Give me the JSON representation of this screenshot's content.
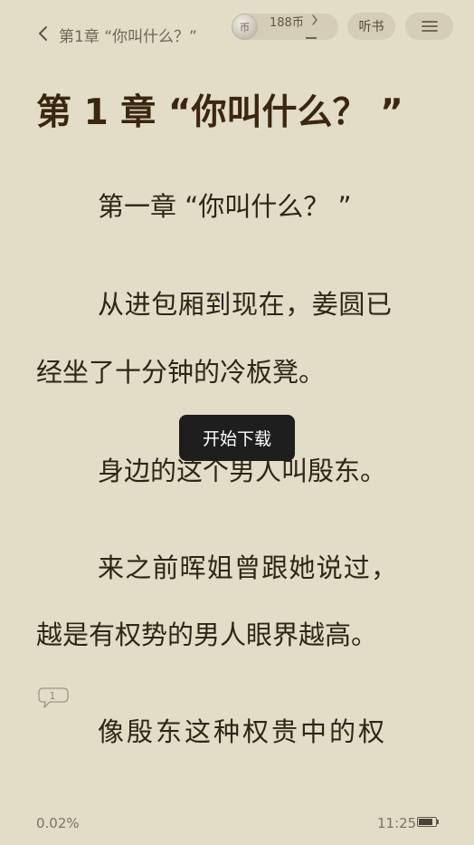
{
  "header": {
    "chapter_title": "第1章 “你叫什么？”",
    "coins": "188币",
    "coin_icon_glyph": "币",
    "listen_label": "听书"
  },
  "content": {
    "heading": "第 1 章 “你叫什么？ ”",
    "lines": [
      "第一章 “你叫什么？ ”",
      "从进包厢到现在，姜圆已",
      "经坐了十分钟的冷板凳。",
      "身边的这个男人叫殷东。",
      "来之前晖姐曾跟她说过，",
      "越是有权势的男人眼界越高。",
      "像殷东这种权贵中的权"
    ],
    "comment_count": "1"
  },
  "toast": {
    "message": "开始下载"
  },
  "footer": {
    "progress": "0.02%",
    "time": "11:25",
    "battery_level": 0.85
  },
  "colors": {
    "background": "#e3dcc6",
    "heading": "#3b2610",
    "text": "#2e2616",
    "pill": "#d5cdb5",
    "toast": "#1e1e1e"
  },
  "icons": {
    "back": "chevron-left-icon",
    "coin": "coin-icon",
    "coin_more": "chevron-right-icon",
    "menu": "hamburger-menu-icon",
    "comment": "comment-bubble-icon",
    "battery": "battery-icon"
  }
}
